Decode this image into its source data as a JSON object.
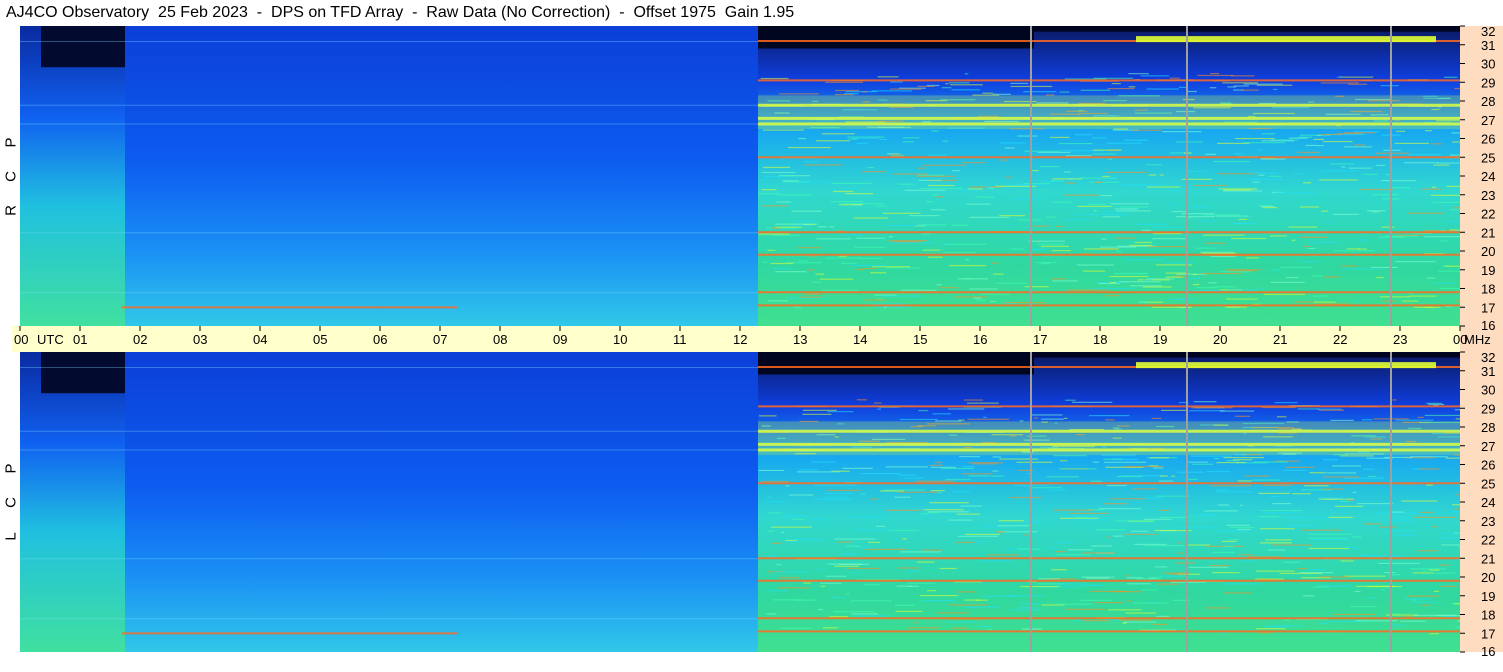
{
  "title": "AJ4CO Observatory  25 Feb 2023  -  DPS on TFD Array  -  Raw Data (No Correction)  -  Offset 1975  Gain 1.95",
  "chart_data": {
    "type": "heatmap",
    "title": "AJ4CO Observatory  25 Feb 2023  -  DPS on TFD Array  -  Raw Data (No Correction)  -  Offset 1975  Gain 1.95",
    "xlabel": "UTC",
    "ylabel": "MHz",
    "x_range_utc_hours": [
      0,
      24
    ],
    "y_range_mhz": [
      16,
      32
    ],
    "x_tick_labels": [
      "00",
      "UTC",
      "01",
      "02",
      "03",
      "04",
      "05",
      "06",
      "07",
      "08",
      "09",
      "10",
      "11",
      "12",
      "13",
      "14",
      "15",
      "16",
      "17",
      "18",
      "19",
      "20",
      "21",
      "22",
      "23",
      "00",
      "MHz"
    ],
    "hour_ticks": [
      "00",
      "01",
      "02",
      "03",
      "04",
      "05",
      "06",
      "07",
      "08",
      "09",
      "10",
      "11",
      "12",
      "13",
      "14",
      "15",
      "16",
      "17",
      "18",
      "19",
      "20",
      "21",
      "22",
      "23",
      "00"
    ],
    "utc_label": "UTC",
    "mhz_label": "MHz",
    "y_ticks": [
      32,
      31,
      30,
      29,
      28,
      27,
      26,
      25,
      24,
      23,
      22,
      21,
      20,
      19,
      18,
      17,
      16
    ],
    "panels": [
      {
        "label": [
          "R",
          "C",
          "P"
        ]
      },
      {
        "label": [
          "L",
          "C",
          "P"
        ]
      }
    ],
    "colormap": [
      "#000030",
      "#00008b",
      "#0050ff",
      "#00c8ff",
      "#40ffb0",
      "#e0ff30",
      "#ff7000",
      "#ff2080",
      "#ffffff"
    ],
    "day_start_utc": 12.3,
    "dark_end_utc": 1.75,
    "vertical_markers_utc": [
      16.85,
      19.45,
      22.85
    ],
    "rfi_bands_mhz": [
      31.2,
      29.1,
      27.8,
      27.1,
      26.8,
      25.0,
      21.0,
      19.8,
      17.8,
      17.1
    ],
    "overlay_trace_mhz": 31.3
  },
  "colors": {
    "title_bg": "#ffffff",
    "time_strip": "#ffffcc",
    "freq_strip": "#fedcc0",
    "marker_line": "#a0a0a0"
  }
}
